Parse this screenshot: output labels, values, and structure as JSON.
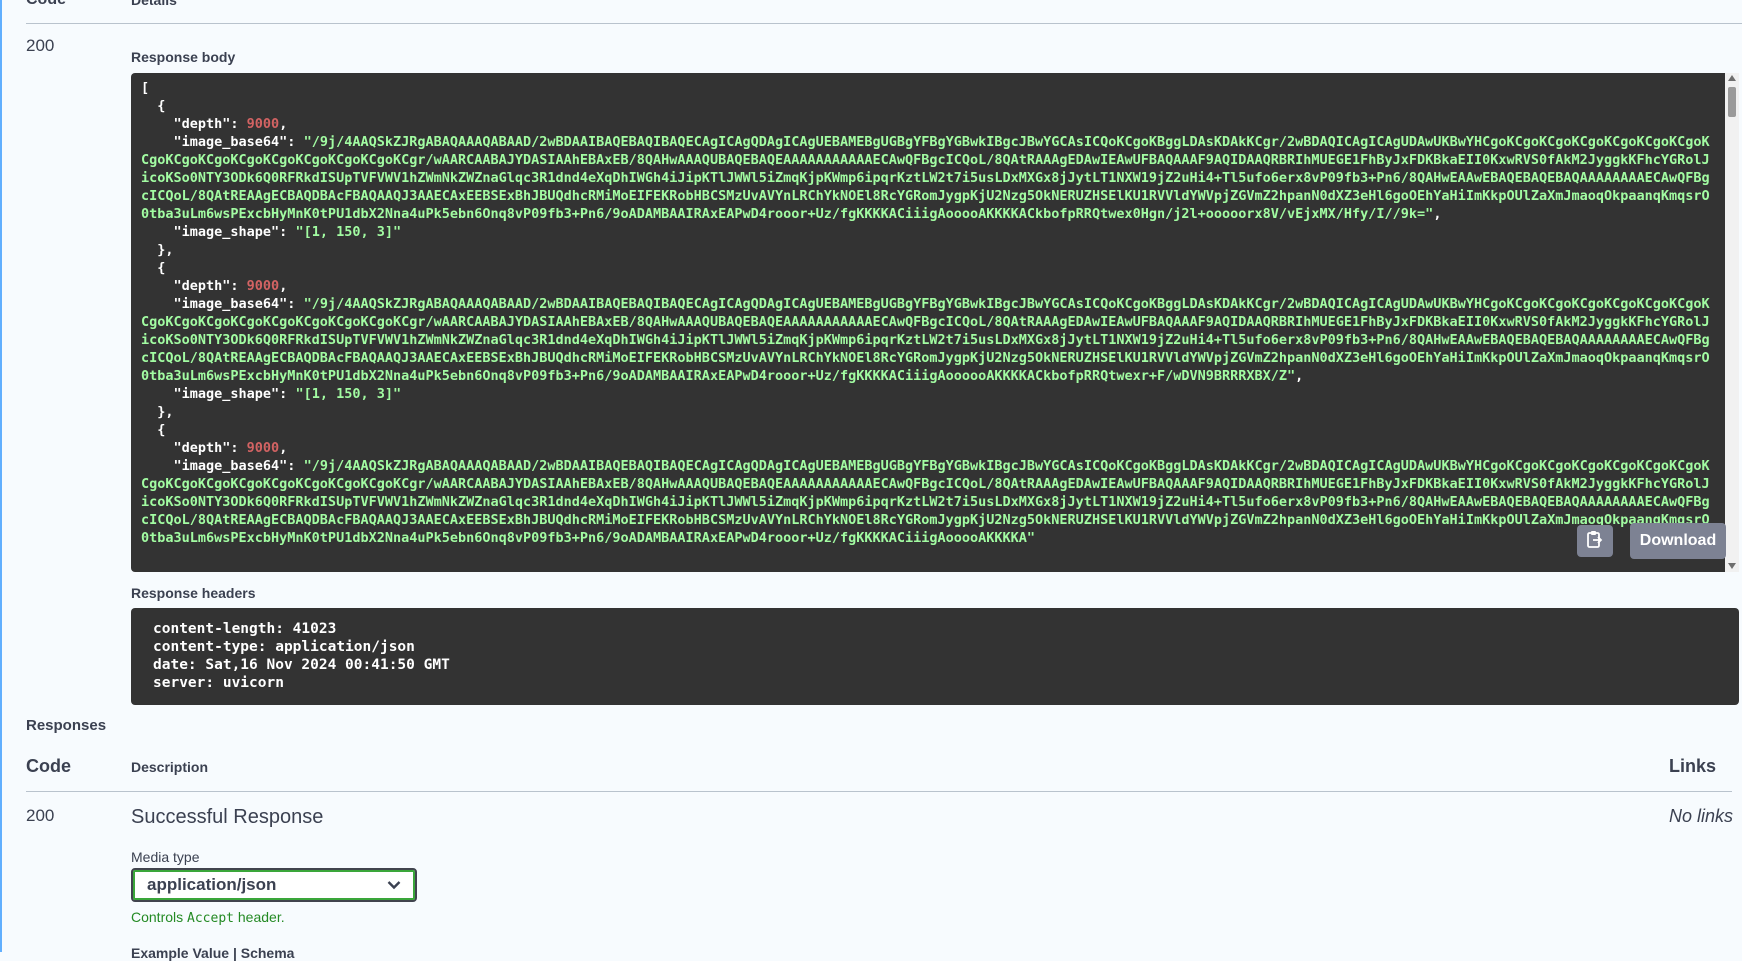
{
  "top": {
    "code_header": "Code",
    "details_header": "Details"
  },
  "result": {
    "code": "200",
    "response_body_label": "Response body",
    "response_body_lines": [
      {
        "t": "[",
        "c": "k"
      },
      {
        "t": "  {",
        "c": "k"
      },
      {
        "parts": [
          {
            "t": "    \"depth\": ",
            "c": "k"
          },
          {
            "t": "9000",
            "c": "n"
          },
          {
            "t": ",",
            "c": "k"
          }
        ]
      },
      {
        "parts": [
          {
            "t": "    \"image_base64\": ",
            "c": "k"
          },
          {
            "t": "\"/9j/4AAQSkZJRgABAQAAAQABAAD/2wBDAAIBAQEBAQIBAQECAgICAgQDAgICAgUEBAMEBgUGBgYFBgYGBwkIBgcJBwYGCAsICQoKCgoKBggLDAsKDAkKCgr/2wBDAQICAgICAgUDAwUKBwYHCgoKCgoKCgoKCgoKCgoKCgoKCgoKCgoKCgoKCgoKCgoKCgoKCgoKCgoKCgoKCgr/wAARCAABAJYDASIAAhEBAxEB/8QAHwAAAQUBAQEBAQEAAAAAAAAAAAECAwQFBgcICQoL/8QAtRAAAgEDAwIEAwUFBAQAAAF9AQIDAAQRBRIhMUEGE1FhByJxFDKBkaEII0KxwRVS0fAkM2JyggkKFhcYGRolJicoKSo0NTY3ODk6Q0RFRkdISUpTVFVWV1hZWmNkZWZnaGlqc3R1dnd4eXqDhIWGh4iJipKTlJWWl5iZmqKjpKWmp6ipqrKztLW2t7i5usLDxMXGx8jJytLT1NXW19jZ2uHi4+Tl5ufo6erx8vP09fb3+Pn6/8QAHwEAAwEBAQEBAQEBAQAAAAAAAAECAwQFBgcICQoL/8QAtREAAgECBAQDBAcFBAQAAQJ3AAECAxEEBSExBhJBUQdhcRMiMoEIFEKRobHBCSMzUvAVYnLRChYkNOEl8RcYGRomJygpKjU2Nzg5OkNERUZHSElKU1RVVldYWVpjZGVmZ2hpanN0dXZ3eHl6goOEhYaHiImKkpOUlZaXmJmaoqOkpaanqKmqsrO0tba3uLm6wsPExcbHyMnK0tPU1dbX2Nna4uPk5ebn6Onq8vP09fb3+Pn6/9oADAMBAAIRAxEAPwD4rooor+Uz/fgKKKKACiiigAooooAKKKKACkbofpRRQtwex0Hgn/j2l+ooooorx8V/vEjxMX/Hfy/I//9k=\"",
            "c": "s"
          },
          {
            "t": ",",
            "c": "k"
          }
        ]
      },
      {
        "parts": [
          {
            "t": "    \"image_shape\": ",
            "c": "k"
          },
          {
            "t": "\"[1, 150, 3]\"",
            "c": "s"
          }
        ]
      },
      {
        "t": "  },",
        "c": "k"
      },
      {
        "t": "  {",
        "c": "k"
      },
      {
        "parts": [
          {
            "t": "    \"depth\": ",
            "c": "k"
          },
          {
            "t": "9000",
            "c": "n"
          },
          {
            "t": ",",
            "c": "k"
          }
        ]
      },
      {
        "parts": [
          {
            "t": "    \"image_base64\": ",
            "c": "k"
          },
          {
            "t": "\"/9j/4AAQSkZJRgABAQAAAQABAAD/2wBDAAIBAQEBAQIBAQECAgICAgQDAgICAgUEBAMEBgUGBgYFBgYGBwkIBgcJBwYGCAsICQoKCgoKBggLDAsKDAkKCgr/2wBDAQICAgICAgUDAwUKBwYHCgoKCgoKCgoKCgoKCgoKCgoKCgoKCgoKCgoKCgoKCgoKCgoKCgoKCgoKCgoKCgr/wAARCAABAJYDASIAAhEBAxEB/8QAHwAAAQUBAQEBAQEAAAAAAAAAAAECAwQFBgcICQoL/8QAtRAAAgEDAwIEAwUFBAQAAAF9AQIDAAQRBRIhMUEGE1FhByJxFDKBkaEII0KxwRVS0fAkM2JyggkKFhcYGRolJicoKSo0NTY3ODk6Q0RFRkdISUpTVFVWV1hZWmNkZWZnaGlqc3R1dnd4eXqDhIWGh4iJipKTlJWWl5iZmqKjpKWmp6ipqrKztLW2t7i5usLDxMXGx8jJytLT1NXW19jZ2uHi4+Tl5ufo6erx8vP09fb3+Pn6/8QAHwEAAwEBAQEBAQEBAQAAAAAAAAECAwQFBgcICQoL/8QAtREAAgECBAQDBAcFBAQAAQJ3AAECAxEEBSExBhJBUQdhcRMiMoEIFEKRobHBCSMzUvAVYnLRChYkNOEl8RcYGRomJygpKjU2Nzg5OkNERUZHSElKU1RVVldYWVpjZGVmZ2hpanN0dXZ3eHl6goOEhYaHiImKkpOUlZaXmJmaoqOkpaanqKmqsrO0tba3uLm6wsPExcbHyMnK0tPU1dbX2Nna4uPk5ebn6Onq8vP09fb3+Pn6/9oADAMBAAIRAxEAPwD4rooor+Uz/fgKKKKACiiigAoooooAKKKKACkbofpRRQtwexr+F/wDVN9BRRRXBX/Z\"",
            "c": "s"
          },
          {
            "t": ",",
            "c": "k"
          }
        ]
      },
      {
        "parts": [
          {
            "t": "    \"image_shape\": ",
            "c": "k"
          },
          {
            "t": "\"[1, 150, 3]\"",
            "c": "s"
          }
        ]
      },
      {
        "t": "  },",
        "c": "k"
      },
      {
        "t": "  {",
        "c": "k"
      },
      {
        "parts": [
          {
            "t": "    \"depth\": ",
            "c": "k"
          },
          {
            "t": "9000",
            "c": "n"
          },
          {
            "t": ",",
            "c": "k"
          }
        ]
      },
      {
        "parts": [
          {
            "t": "    \"image_base64\": ",
            "c": "k"
          },
          {
            "t": "\"/9j/4AAQSkZJRgABAQAAAQABAAD/2wBDAAIBAQEBAQIBAQECAgICAgQDAgICAgUEBAMEBgUGBgYFBgYGBwkIBgcJBwYGCAsICQoKCgoKBggLDAsKDAkKCgr/2wBDAQICAgICAgUDAwUKBwYHCgoKCgoKCgoKCgoKCgoKCgoKCgoKCgoKCgoKCgoKCgoKCgoKCgoKCgoKCgoKCgr/wAARCAABAJYDASIAAhEBAxEB/8QAHwAAAQUBAQEBAQEAAAAAAAAAAAECAwQFBgcICQoL/8QAtRAAAgEDAwIEAwUFBAQAAAF9AQIDAAQRBRIhMUEGE1FhByJxFDKBkaEII0KxwRVS0fAkM2JyggkKFhcYGRolJicoKSo0NTY3ODk6Q0RFRkdISUpTVFVWV1hZWmNkZWZnaGlqc3R1dnd4eXqDhIWGh4iJipKTlJWWl5iZmqKjpKWmp6ipqrKztLW2t7i5usLDxMXGx8jJytLT1NXW19jZ2uHi4+Tl5ufo6erx8vP09fb3+Pn6/8QAHwEAAwEBAQEBAQEBAQAAAAAAAAECAwQFBgcICQoL/8QAtREAAgECBAQDBAcFBAQAAQJ3AAECAxEEBSExBhJBUQdhcRMiMoEIFEKRobHBCSMzUvAVYnLRChYkNOEl8RcYGRomJygpKjU2Nzg5OkNERUZHSElKU1RVVldYWVpjZGVmZ2hpanN0dXZ3eHl6goOEhYaHiImKkpOUlZaXmJmaoqOkpaanqKmqsrO0tba3uLm6wsPExcbHyMnK0tPU1dbX2Nna4uPk5ebn6Onq8vP09fb3+Pn6/9oADAMBAAIRAxEAPwD4rooor+Uz/fgKKKKACiiigAooooAKKKKA\"",
            "c": "s"
          }
        ]
      }
    ],
    "copy_icon": "clipboard-icon",
    "download_label": "Download",
    "response_headers_label": "Response headers",
    "response_headers_text": "content-length: 41023\ncontent-type: application/json\ndate: Sat,16 Nov 2024 00:41:50 GMT\nserver: uvicorn"
  },
  "responses": {
    "title": "Responses",
    "col_code": "Code",
    "col_description": "Description",
    "col_links": "Links",
    "row": {
      "code": "200",
      "description": "Successful Response",
      "links": "No links",
      "media_type_label": "Media type",
      "media_type_value": "application/json",
      "note_prefix": "Controls ",
      "note_code": "Accept",
      "note_suffix": " header.",
      "example_tabs": "Example Value | Schema"
    }
  },
  "colors": {
    "json_key": "#ffffff",
    "json_number": "#d36363",
    "json_string": "#a2fca2",
    "accent_green": "#248a24"
  }
}
